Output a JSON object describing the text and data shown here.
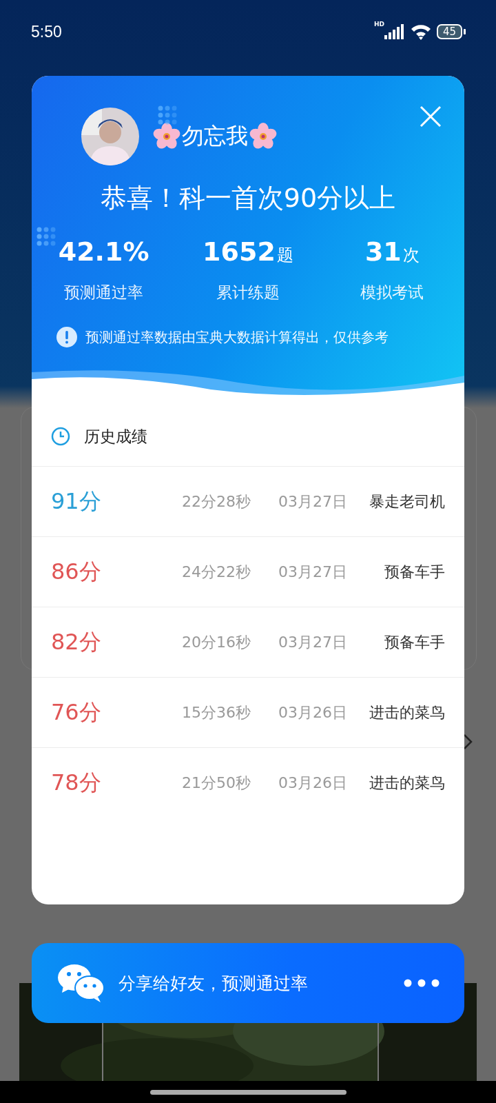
{
  "status_bar": {
    "time": "5:50",
    "battery": "45",
    "network": "HD"
  },
  "result_card": {
    "user_name": "勿忘我",
    "headline": "恭喜！科一首次90分以上",
    "stats": [
      {
        "value": "42.1%",
        "label": "预测通过率"
      },
      {
        "value": "1652",
        "unit": "题",
        "label": "累计练题"
      },
      {
        "value": "31",
        "unit": "次",
        "label": "模拟考试"
      }
    ],
    "notice": "预测通过率数据由宝典大数据计算得出，仅供参考",
    "history_title": "历史成绩",
    "history": [
      {
        "score": "91分",
        "color": "#2a9fd6",
        "duration": "22分28秒",
        "date": "03月27日",
        "title": "暴走老司机"
      },
      {
        "score": "86分",
        "color": "#e05555",
        "duration": "24分22秒",
        "date": "03月27日",
        "title": "预备车手"
      },
      {
        "score": "82分",
        "color": "#e05555",
        "duration": "20分16秒",
        "date": "03月27日",
        "title": "预备车手"
      },
      {
        "score": "76分",
        "color": "#e05555",
        "duration": "15分36秒",
        "date": "03月26日",
        "title": "进击的菜鸟"
      },
      {
        "score": "78分",
        "color": "#e05555",
        "duration": "21分50秒",
        "date": "03月26日",
        "title": "进击的菜鸟"
      }
    ]
  },
  "share_bar": {
    "label": "分享给好友，预测通过率"
  }
}
